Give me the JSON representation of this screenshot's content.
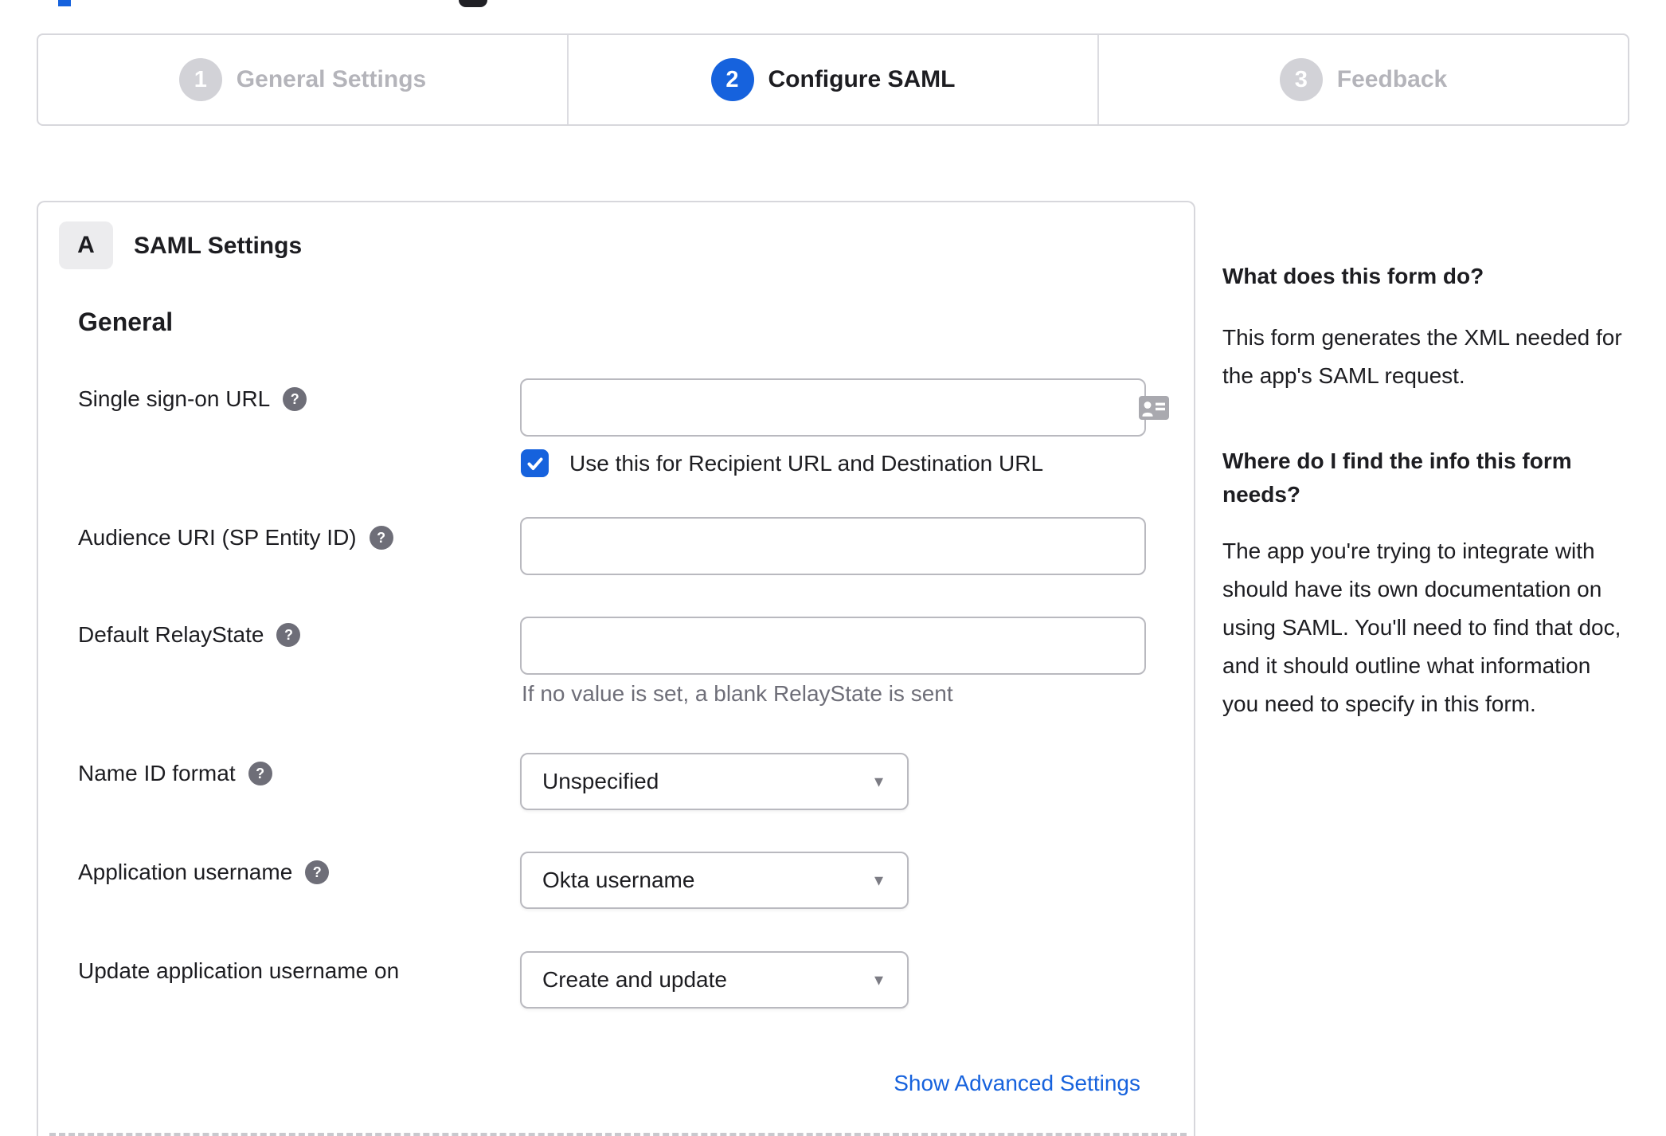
{
  "icons": {
    "help_glyph": "?",
    "caret_glyph": "▾"
  },
  "colors": {
    "accent_blue": "#1662dd",
    "text": "#1d1d21",
    "muted_text": "#6e6e78",
    "border": "#d7d7dc",
    "inactive_step": "#b4b4ba"
  },
  "stepper": {
    "steps": [
      {
        "number": "1",
        "label": "General Settings",
        "state": "inactive"
      },
      {
        "number": "2",
        "label": "Configure SAML",
        "state": "active"
      },
      {
        "number": "3",
        "label": "Feedback",
        "state": "inactive"
      }
    ]
  },
  "panel": {
    "section_badge": "A",
    "section_title": "SAML Settings",
    "group_title": "General",
    "fields": [
      {
        "label": "Single sign-on URL",
        "value": "",
        "checkbox_label": "Use this for Recipient URL and Destination URL",
        "checkbox_checked": true
      },
      {
        "label": "Audience URI (SP Entity ID)",
        "value": ""
      },
      {
        "label": "Default RelayState",
        "value": "",
        "hint": "If no value is set, a blank RelayState is sent"
      },
      {
        "label": "Name ID format",
        "value": "Unspecified"
      },
      {
        "label": "Application username",
        "value": "Okta username"
      },
      {
        "label": "Update application username on",
        "value": "Create and update"
      }
    ],
    "advanced_link": "Show Advanced Settings"
  },
  "sidebar": {
    "sections": [
      {
        "heading": "What does this form do?",
        "body": "This form generates the XML needed for the app's SAML request."
      },
      {
        "heading": "Where do I find the info this form needs?",
        "body": "The app you're trying to integrate with should have its own documentation on using SAML. You'll need to find that doc, and it should outline what information you need to specify in this form."
      }
    ]
  }
}
